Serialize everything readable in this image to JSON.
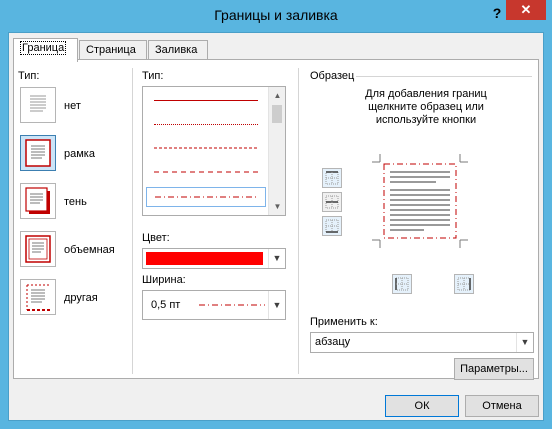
{
  "window": {
    "title": "Границы и заливка",
    "help_label": "?",
    "close_label": "✕"
  },
  "tabs": [
    {
      "label": "Граница",
      "active": true
    },
    {
      "label": "Страница",
      "active": false
    },
    {
      "label": "Заливка",
      "active": false
    }
  ],
  "setting": {
    "label": "Тип:",
    "items": [
      {
        "label": "нет",
        "selected": false,
        "icon": "border-none-icon"
      },
      {
        "label": "рамка",
        "selected": true,
        "icon": "border-box-icon"
      },
      {
        "label": "тень",
        "selected": false,
        "icon": "border-shadow-icon"
      },
      {
        "label": "объемная",
        "selected": false,
        "icon": "border-3d-icon"
      },
      {
        "label": "другая",
        "selected": false,
        "icon": "border-custom-icon"
      }
    ]
  },
  "style": {
    "label": "Тип:",
    "selected_index": 4,
    "items": [
      {
        "style": "solid"
      },
      {
        "style": "dotted"
      },
      {
        "style": "dashed-small"
      },
      {
        "style": "dashed"
      },
      {
        "style": "dash-dot"
      }
    ]
  },
  "color": {
    "label": "Цвет:",
    "value": "#ff0000"
  },
  "width": {
    "label": "Ширина:",
    "value": "0,5 пт"
  },
  "preview": {
    "label": "Образец",
    "hint": "Для добавления границ щелкните образец или используйте кнопки",
    "line_color": "#c00000",
    "buttons_left": [
      "border-top-icon",
      "border-between-icon",
      "border-bottom-icon"
    ],
    "buttons_bottom": [
      "border-left-icon",
      "border-right-icon"
    ]
  },
  "apply_to": {
    "label": "Применить к:",
    "value": "абзацу"
  },
  "options_button": "Параметры...",
  "ok_button": "ОК",
  "cancel_button": "Отмена"
}
